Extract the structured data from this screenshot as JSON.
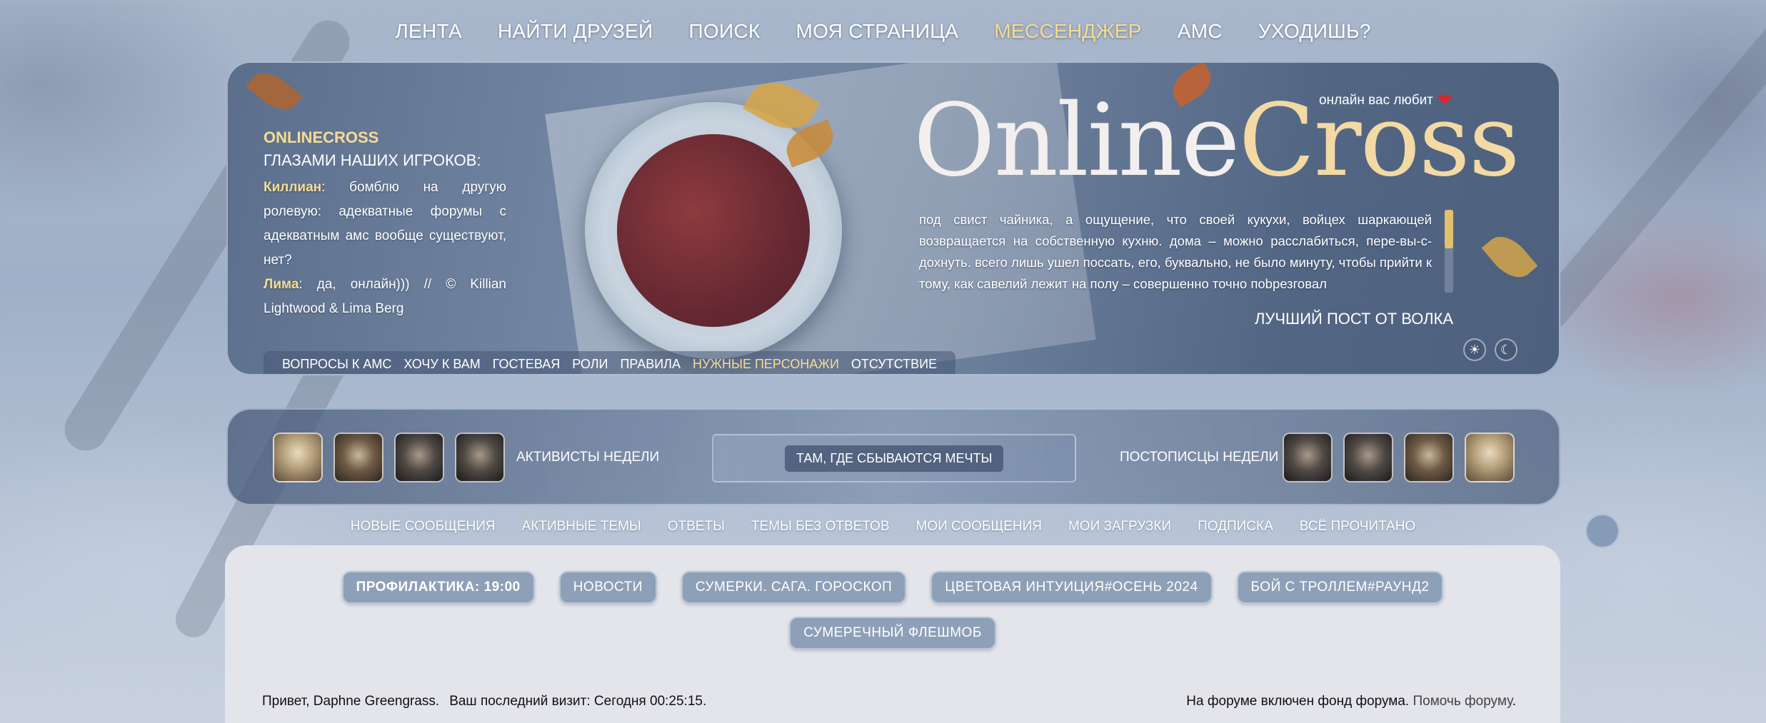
{
  "top_nav": [
    {
      "label": "ЛЕНТА",
      "active": false
    },
    {
      "label": "НАЙТИ ДРУЗЕЙ",
      "active": false
    },
    {
      "label": "ПОИСК",
      "active": false
    },
    {
      "label": "МОЯ СТРАНИЦА",
      "active": false
    },
    {
      "label": "МЕССЕНДЖЕР",
      "active": true
    },
    {
      "label": "АМС",
      "active": false
    },
    {
      "label": "УХОДИШЬ?",
      "active": false
    }
  ],
  "banner": {
    "site_name": "ONLINECROSS",
    "players_heading": "ГЛАЗАМИ НАШИХ ИГРОКОВ:",
    "quote_name1": "Киллиан",
    "quote_text1": ": бомблю на другую ролевую: адекватные форумы с адекватным амс вообще существуют, нет?",
    "quote_name2": "Лима",
    "quote_text2": ": да, онлайн))) // © Killian Lightwood & Lima Berg",
    "online_love": "онлайн вас любит",
    "online_love_icon": "heart-icon",
    "logo_part1": "Online",
    "logo_part2": "Cross",
    "best_post_text": "под свист чайника, а ощущение, что своей кукухи, войцех шаркающей возвращается на собственную кухню. дома – можно расслабиться, пере-вы-с-дохнуть. всего лишь ушел поссать, его, буквально, не было минуту, чтобы прийти к тому, как савелий лежит на полу – совершенно точно пobрезговал",
    "best_post_label": "ЛУЧШИЙ ПОСТ ОТ ВОЛКА",
    "theme_light_icon": "sun-icon",
    "theme_dark_icon": "moon-icon"
  },
  "sub_nav": [
    {
      "label": "ВОПРОСЫ К АМС",
      "active": false
    },
    {
      "label": "ХОЧУ К ВАМ",
      "active": false
    },
    {
      "label": "ГОСТЕВАЯ",
      "active": false
    },
    {
      "label": "РОЛИ",
      "active": false
    },
    {
      "label": "ПРАВИЛА",
      "active": false
    },
    {
      "label": "НУЖНЫЕ ПЕРСОНАЖИ",
      "active": true
    },
    {
      "label": "ОТСУТСТВИЕ",
      "active": false
    }
  ],
  "activists": {
    "label_left": "АКТИВИСТЫ НЕДЕЛИ",
    "center_label": "ТАМ, ГДЕ СБЫВАЮТСЯ МЕЧТЫ",
    "label_right": "ПОСТОПИСЦЫ НЕДЕЛИ"
  },
  "forum_links": [
    "НОВЫЕ СООБЩЕНИЯ",
    "АКТИВНЫЕ ТЕМЫ",
    "ОТВЕТЫ",
    "ТЕМЫ БЕЗ ОТВЕТОВ",
    "МОИ СООБЩЕНИЯ",
    "МОИ ЗАГРУЗКИ",
    "ПОДПИСКА",
    "ВСЁ ПРОЧИТАНО"
  ],
  "tags": [
    "ПРОФИЛАКТИКА: 19:00",
    "НОВОСТИ",
    "СУМЕРКИ. САГА. ГОРОСКОП",
    "ЦВЕТОВАЯ ИНТУИЦИЯ#ОСЕНЬ 2024",
    "БОЙ С ТРОЛЛЕМ#РАУНД2",
    "СУМЕРЕЧНЫЙ ФЛЕШМОБ"
  ],
  "status": {
    "greeting": "Привет, Daphne Greengrass.",
    "last_visit": "Ваш последний визит: Сегодня 00:25:15.",
    "fund_text": "На форуме включен фонд форума.",
    "fund_link": "Помочь форуму",
    "fund_end": "."
  },
  "colors": {
    "accent_gold": "#f6dc91",
    "heart": "#e0242a",
    "tag_bg": "#8ea0b8",
    "panel_bg": "#e4e4eb"
  }
}
